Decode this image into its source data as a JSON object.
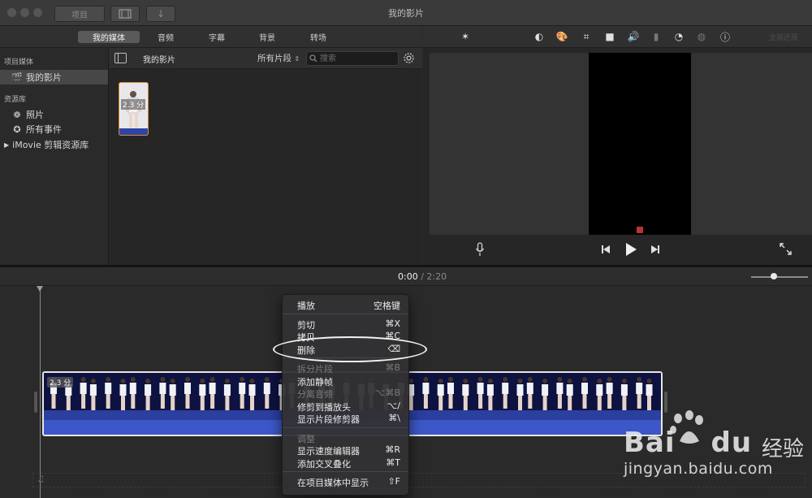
{
  "window": {
    "title": "我的影片",
    "toolbar": {
      "project_label": "项目"
    }
  },
  "browser_tabs": [
    {
      "label": "我的媒体",
      "active": true
    },
    {
      "label": "音频",
      "active": false
    },
    {
      "label": "字幕",
      "active": false
    },
    {
      "label": "背景",
      "active": false
    },
    {
      "label": "转场",
      "active": false
    }
  ],
  "sidebar": {
    "section_project": "项目媒体",
    "project_item": "我的影片",
    "section_library": "资源库",
    "library_items": [
      "照片",
      "所有事件"
    ],
    "library_group": "iMovie 剪辑资源库"
  },
  "browser": {
    "title": "我的影片",
    "filter": "所有片段",
    "search_placeholder": "搜索",
    "clip_duration": "2.3 分"
  },
  "viewer": {
    "reset_label": "全部还原"
  },
  "timeline": {
    "current_time": "0:00",
    "separator": "/",
    "total_time": "2:20",
    "clip_duration": "2.3 分",
    "zoom_level": 0.4
  },
  "context_menu": {
    "groups": [
      [
        {
          "label": "播放",
          "shortcut": "空格键",
          "enabled": true
        }
      ],
      [
        {
          "label": "剪切",
          "shortcut": "⌘X",
          "enabled": true
        },
        {
          "label": "拷贝",
          "shortcut": "⌘C",
          "enabled": true
        },
        {
          "label": "删除",
          "shortcut": "⌫",
          "enabled": true
        }
      ],
      [
        {
          "label": "拆分片段",
          "shortcut": "⌘B",
          "enabled": false
        },
        {
          "label": "添加静帧",
          "shortcut": "",
          "enabled": true
        },
        {
          "label": "分离音频",
          "shortcut": "⌥⌘B",
          "enabled": false
        },
        {
          "label": "修剪到播放头",
          "shortcut": "⌥/",
          "enabled": true
        },
        {
          "label": "显示片段修剪器",
          "shortcut": "⌘\\",
          "enabled": true
        }
      ],
      [
        {
          "label": "调整",
          "shortcut": "",
          "enabled": false
        },
        {
          "label": "显示速度编辑器",
          "shortcut": "⌘R",
          "enabled": true
        },
        {
          "label": "添加交叉叠化",
          "shortcut": "⌘T",
          "enabled": true
        }
      ],
      [
        {
          "label": "在项目媒体中显示",
          "shortcut": "⇧F",
          "enabled": true
        }
      ]
    ]
  },
  "watermark": {
    "brand": "Bai",
    "brand_suffix": "du",
    "product": "经验",
    "url": "jingyan.baidu.com"
  },
  "colors": {
    "clip_selection": "#e6e6e6",
    "clip_audio": "#3c57c7",
    "thumb_border": "#d98c2a",
    "tab_active": "#5a5a5a"
  }
}
